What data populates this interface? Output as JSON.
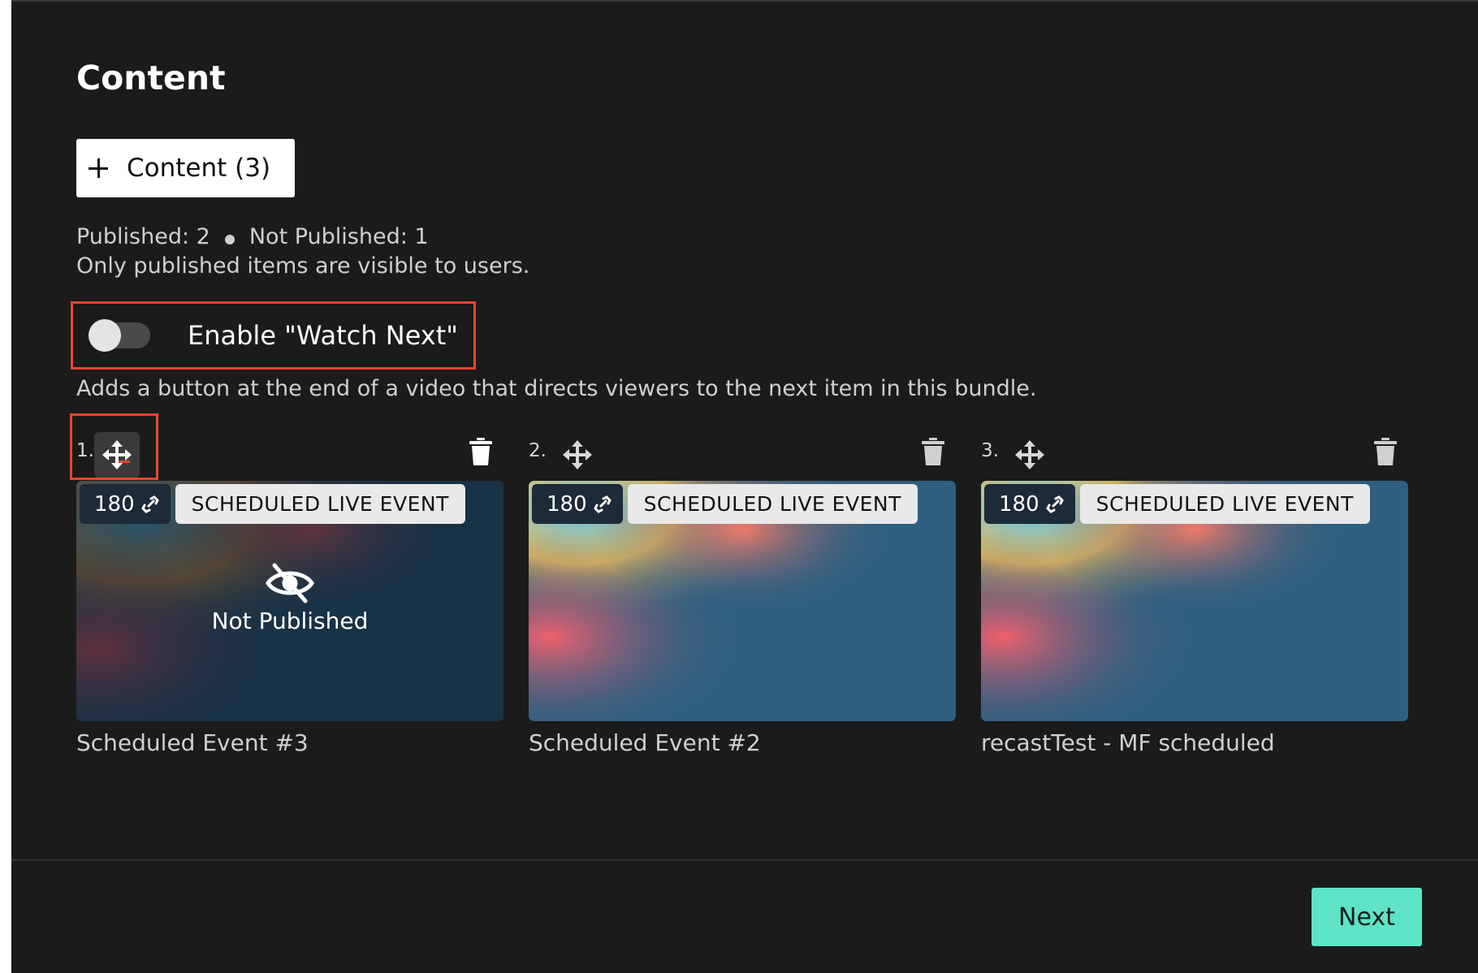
{
  "section": {
    "title": "Content"
  },
  "add_content": {
    "label": "Content (3)",
    "icon": "plus-icon"
  },
  "stats": {
    "published": "Published: 2",
    "not_published": "Not Published: 1",
    "note": "Only published items are visible to users."
  },
  "watch_next": {
    "label": "Enable \"Watch Next\"",
    "enabled": false,
    "description": "Adds a button at the end of a video that directs viewers to the next item in this bundle."
  },
  "items": [
    {
      "index": "1.",
      "count": "180",
      "type": "SCHEDULED LIVE EVENT",
      "title": "Scheduled Event #3",
      "published": false,
      "overlay_label": "Not Published"
    },
    {
      "index": "2.",
      "count": "180",
      "type": "SCHEDULED LIVE EVENT",
      "title": "Scheduled Event #2",
      "published": true
    },
    {
      "index": "3.",
      "count": "180",
      "type": "SCHEDULED LIVE EVENT",
      "title": "recastTest - MF scheduled",
      "published": true
    }
  ],
  "footer": {
    "next_label": "Next"
  },
  "colors": {
    "panel_bg": "#1b1b1b",
    "highlight": "#e8472c",
    "accent": "#5fe3c6",
    "thumb_bg": "#2f5f80"
  }
}
